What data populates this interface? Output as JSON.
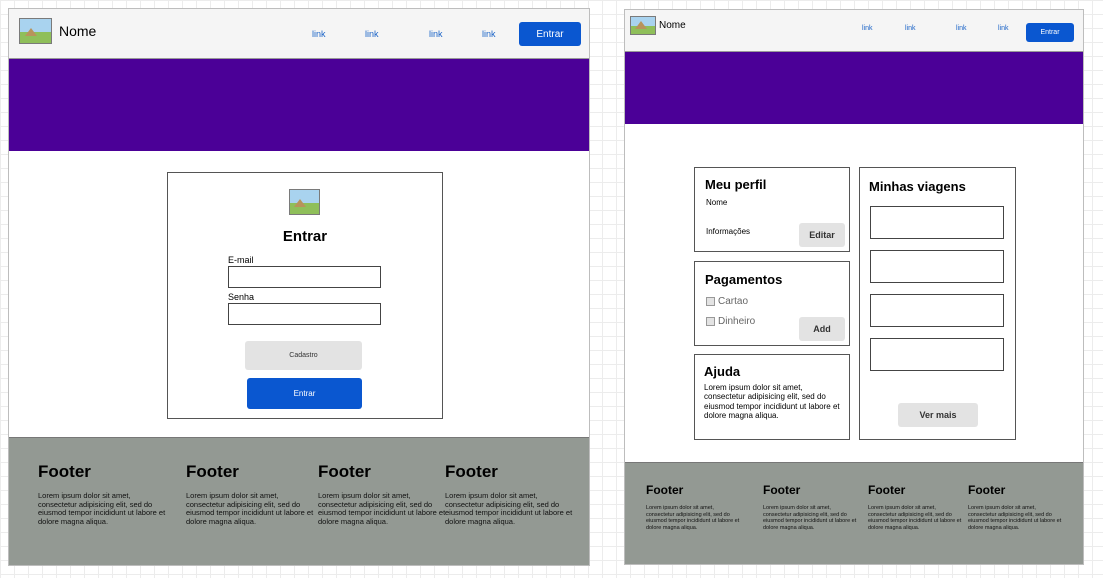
{
  "login_page": {
    "nav": {
      "brand": "Nome",
      "links": [
        "link",
        "link",
        "link",
        "link"
      ],
      "cta": "Entrar"
    },
    "form": {
      "title": "Entrar",
      "email_label": "E-mail",
      "password_label": "Senha",
      "signup_button": "Cadastro",
      "submit_button": "Entrar"
    },
    "footer": [
      {
        "title": "Footer",
        "text": "Lorem ipsum dolor sit amet, consectetur adipisicing elit, sed do eiusmod tempor incididunt ut labore et dolore magna aliqua."
      },
      {
        "title": "Footer",
        "text": "Lorem ipsum dolor sit amet, consectetur adipisicing elit, sed do eiusmod tempor incididunt ut labore et dolore magna aliqua."
      },
      {
        "title": "Footer",
        "text": "Lorem ipsum dolor sit amet, consectetur adipisicing elit, sed do eiusmod tempor incididunt ut labore et dolore magna aliqua."
      },
      {
        "title": "Footer",
        "text": "Lorem ipsum dolor sit amet, consectetur adipisicing elit, sed do eiusmod tempor incididunt ut labore et dolore magna aliqua."
      }
    ]
  },
  "profile_page": {
    "nav": {
      "brand": "Nome",
      "links": [
        "link",
        "link",
        "link",
        "link"
      ],
      "cta": "Entrar"
    },
    "profile_card": {
      "title": "Meu perfil",
      "name": "Nome",
      "info": "Informações",
      "edit_button": "Editar"
    },
    "payments_card": {
      "title": "Pagamentos",
      "options": [
        "Cartao",
        "Dinheiro"
      ],
      "add_button": "Add"
    },
    "help_card": {
      "title": "Ajuda",
      "text": "Lorem ipsum dolor sit amet, consectetur adipisicing elit, sed do eiusmod tempor incididunt ut labore et dolore magna aliqua."
    },
    "trips_card": {
      "title": "Minhas viagens",
      "more_button": "Ver mais"
    },
    "footer": [
      {
        "title": "Footer",
        "text": "Lorem ipsum dolor sit amet, consectetur adipisicing elit, sed do eiusmod tempor incididunt ut labore et dolore magna aliqua."
      },
      {
        "title": "Footer",
        "text": "Lorem ipsum dolor sit amet, consectetur adipisicing elit, sed do eiusmod tempor incididunt ut labore et dolore magna aliqua."
      },
      {
        "title": "Footer",
        "text": "Lorem ipsum dolor sit amet, consectetur adipisicing elit, sed do eiusmod tempor incididunt ut labore et dolore magna aliqua."
      },
      {
        "title": "Footer",
        "text": "Lorem ipsum dolor sit amet, consectetur adipisicing elit, sed do eiusmod tempor incididunt ut labore et dolore magna aliqua."
      }
    ]
  },
  "colors": {
    "banner": "#4b0097",
    "primary_button": "#0a57d0",
    "footer": "#939993",
    "link": "#1a63c7"
  }
}
